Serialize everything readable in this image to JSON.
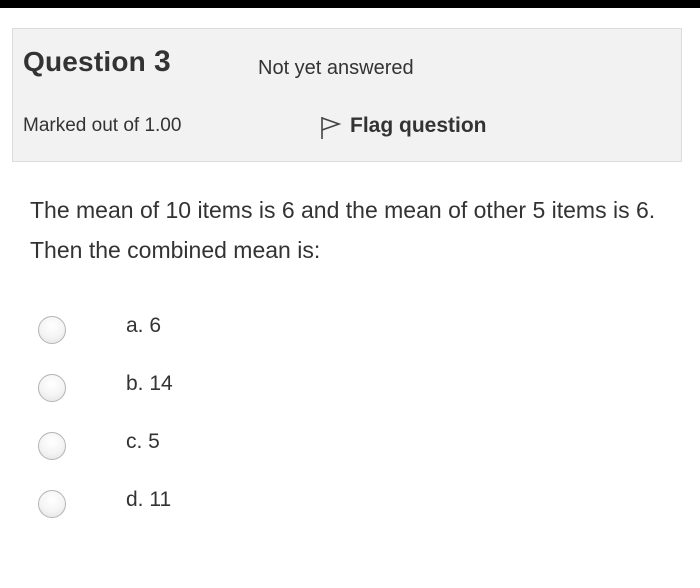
{
  "question": {
    "label": "Question",
    "number": "3",
    "state": "Not yet answered",
    "grade": "Marked out of 1.00",
    "flag_label": "Flag question",
    "text": "The mean of 10 items is 6 and the mean of other 5 items is 6. Then the combined mean is:"
  },
  "answers": [
    {
      "label": "a. 6"
    },
    {
      "label": "b. 14"
    },
    {
      "label": "c. 5"
    },
    {
      "label": "d. 11"
    }
  ],
  "icons": {
    "flag": "flag-icon"
  }
}
